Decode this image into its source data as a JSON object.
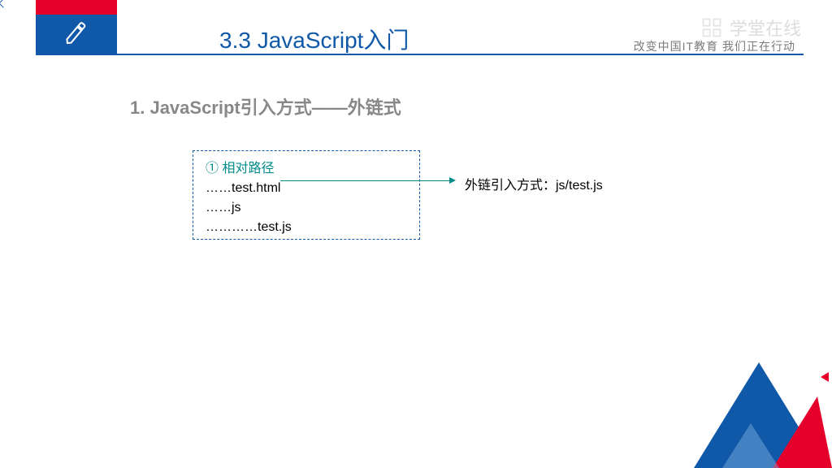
{
  "header": {
    "title": "3.3 JavaScript入门",
    "tagline": "改变中国IT教育 我们正在行动",
    "watermark": "学堂在线"
  },
  "content": {
    "subtitle": "1.   JavaScript引入方式——外链式",
    "box": {
      "line1": "① 相对路径",
      "line2": "……test.html",
      "line3": "……js",
      "line4": "…………test.js"
    },
    "external": "外链引入方式：js/test.js"
  }
}
